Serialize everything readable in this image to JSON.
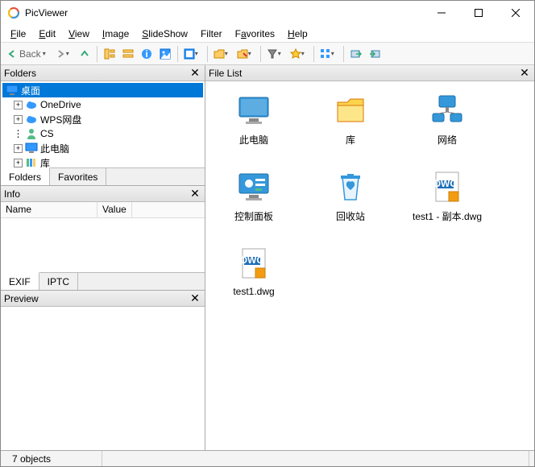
{
  "app": {
    "title": "PicViewer"
  },
  "menus": [
    "File",
    "Edit",
    "View",
    "Image",
    "SlideShow",
    "Filter",
    "Favorites",
    "Help"
  ],
  "toolbar": {
    "back_label": "Back"
  },
  "panels": {
    "folders_title": "Folders",
    "info_title": "Info",
    "preview_title": "Preview",
    "filelist_title": "File List"
  },
  "tree": {
    "root": "桌面",
    "items": [
      "OneDrive",
      "WPS网盘",
      "CS",
      "此电脑",
      "库"
    ]
  },
  "left_tabs": {
    "folders": "Folders",
    "favorites": "Favorites"
  },
  "info_cols": {
    "name": "Name",
    "value": "Value"
  },
  "info_tabs": {
    "exif": "EXIF",
    "iptc": "IPTC"
  },
  "files": [
    {
      "label": "此电脑",
      "icon": "monitor"
    },
    {
      "label": "库",
      "icon": "folder"
    },
    {
      "label": "网络",
      "icon": "network"
    },
    {
      "label": "控制面板",
      "icon": "control-panel"
    },
    {
      "label": "回收站",
      "icon": "recycle-bin"
    },
    {
      "label": "test1 - 副本.dwg",
      "icon": "dwg"
    },
    {
      "label": "test1.dwg",
      "icon": "dwg"
    }
  ],
  "status": {
    "objects": "7 objects"
  }
}
